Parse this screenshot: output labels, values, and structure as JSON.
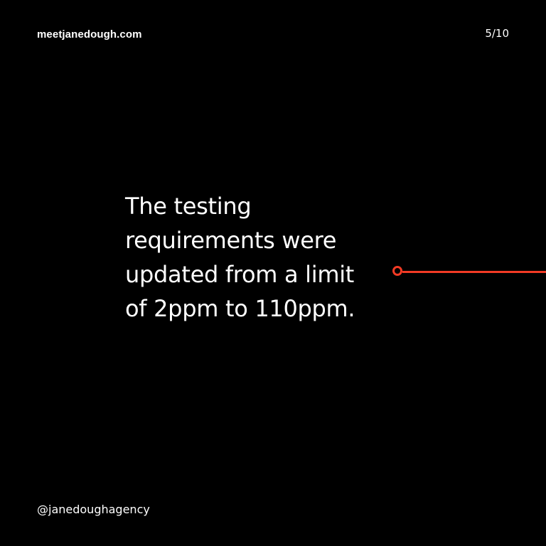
{
  "header": {
    "site_url": "meetjanedough.com",
    "page_counter": "5/10"
  },
  "main": {
    "body_lines": [
      "The testing",
      "requirements were",
      "updated from a limit",
      "of 2ppm to 110ppm."
    ]
  },
  "footer": {
    "handle": "@janedoughagency"
  },
  "colors": {
    "background": "#000000",
    "text": "#ffffff",
    "accent": "#f23a24"
  }
}
